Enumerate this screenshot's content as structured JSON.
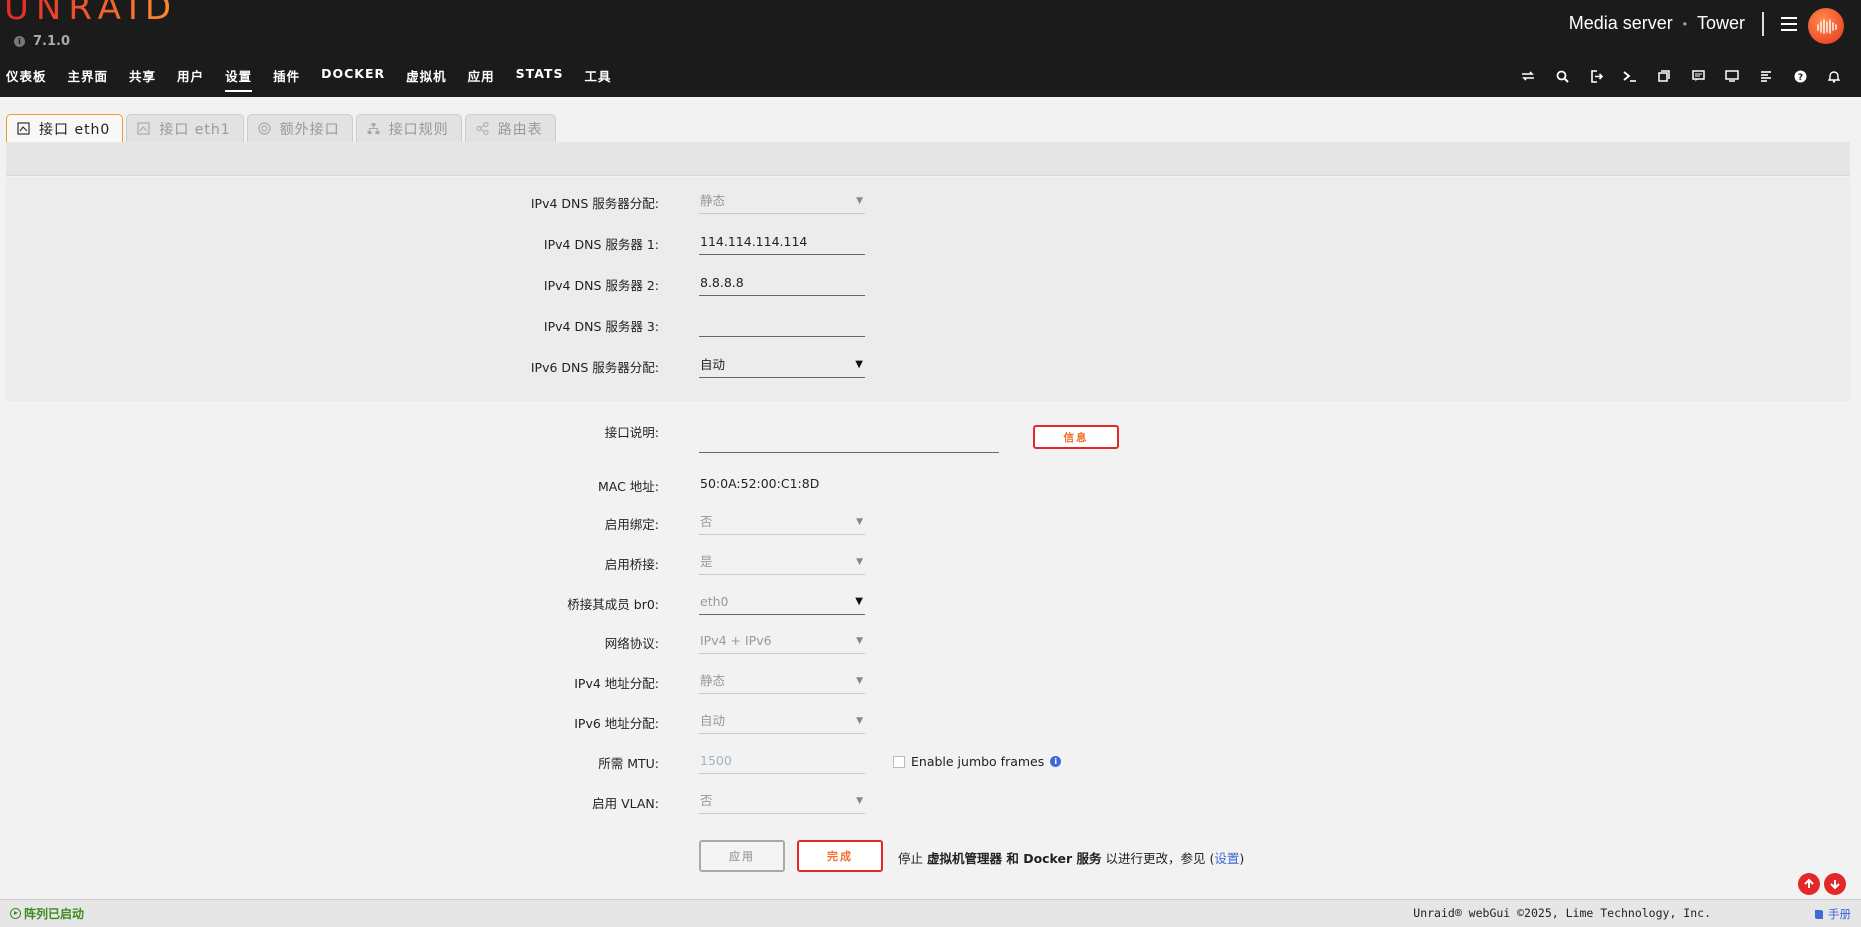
{
  "header": {
    "logo_text": "UNRAID",
    "version": "7.1.0",
    "server_description": "Media server",
    "server_name": "Tower",
    "brand_color": "#e22828",
    "accent_color": "#ff8c2f"
  },
  "nav": {
    "items": [
      "仪表板",
      "主界面",
      "共享",
      "用户",
      "设置",
      "插件",
      "DOCKER",
      "虚拟机",
      "应用",
      "STATS",
      "工具"
    ],
    "active": "设置",
    "icons": [
      "switch-language-icon",
      "search-icon",
      "logout-icon",
      "terminal-icon",
      "feedback-icon",
      "notes-icon",
      "display-icon",
      "log-icon",
      "help-icon",
      "bell-icon"
    ]
  },
  "tabs": [
    {
      "label": "接口 eth0",
      "icon": "network-card-icon",
      "active": true
    },
    {
      "label": "接口 eth1",
      "icon": "network-card-icon",
      "active": false
    },
    {
      "label": "额外接口",
      "icon": "target-icon",
      "active": false
    },
    {
      "label": "接口规则",
      "icon": "sitemap-icon",
      "active": false
    },
    {
      "label": "路由表",
      "icon": "share-icon",
      "active": false
    }
  ],
  "dns": {
    "ipv4_assign_label": "IPv4 DNS 服务器分配:",
    "ipv4_assign_value": "静态",
    "ipv4_dns1_label": "IPv4 DNS 服务器 1:",
    "ipv4_dns1_value": "114.114.114.114",
    "ipv4_dns2_label": "IPv4 DNS 服务器 2:",
    "ipv4_dns2_value": "8.8.8.8",
    "ipv4_dns3_label": "IPv4 DNS 服务器 3:",
    "ipv4_dns3_value": "",
    "ipv6_assign_label": "IPv6 DNS 服务器分配:",
    "ipv6_assign_value": "自动"
  },
  "iface": {
    "desc_label": "接口说明:",
    "desc_value": "",
    "info_button": "信息",
    "mac_label": "MAC 地址:",
    "mac_value": "50:0A:52:00:C1:8D",
    "bonding_label": "启用绑定:",
    "bonding_value": "否",
    "bridging_label": "启用桥接:",
    "bridging_value": "是",
    "bridge_members_label": "桥接其成员 br0:",
    "bridge_members_value": "eth0",
    "protocol_label": "网络协议:",
    "protocol_value": "IPv4 + IPv6",
    "ipv4_assign_label": "IPv4 地址分配:",
    "ipv4_assign_value": "静态",
    "ipv6_assign_label": "IPv6 地址分配:",
    "ipv6_assign_value": "自动",
    "mtu_label": "所需 MTU:",
    "mtu_placeholder": "1500",
    "jumbo_label": "Enable jumbo frames",
    "vlan_label": "启用 VLAN:",
    "vlan_value": "否"
  },
  "actions": {
    "apply_label": "应用",
    "done_label": "完成",
    "note_prefix": "停止 ",
    "note_bold": "虚拟机管理器 和 Docker 服务",
    "note_mid": " 以进行更改，参见 (",
    "note_link": "设置",
    "note_suffix": ")"
  },
  "footer": {
    "array_status": "阵列已启动",
    "copyright": "Unraid® webGui ©2025, Lime Technology, Inc.",
    "manual_label": "手册",
    "status_color": "#3d8b1f"
  }
}
